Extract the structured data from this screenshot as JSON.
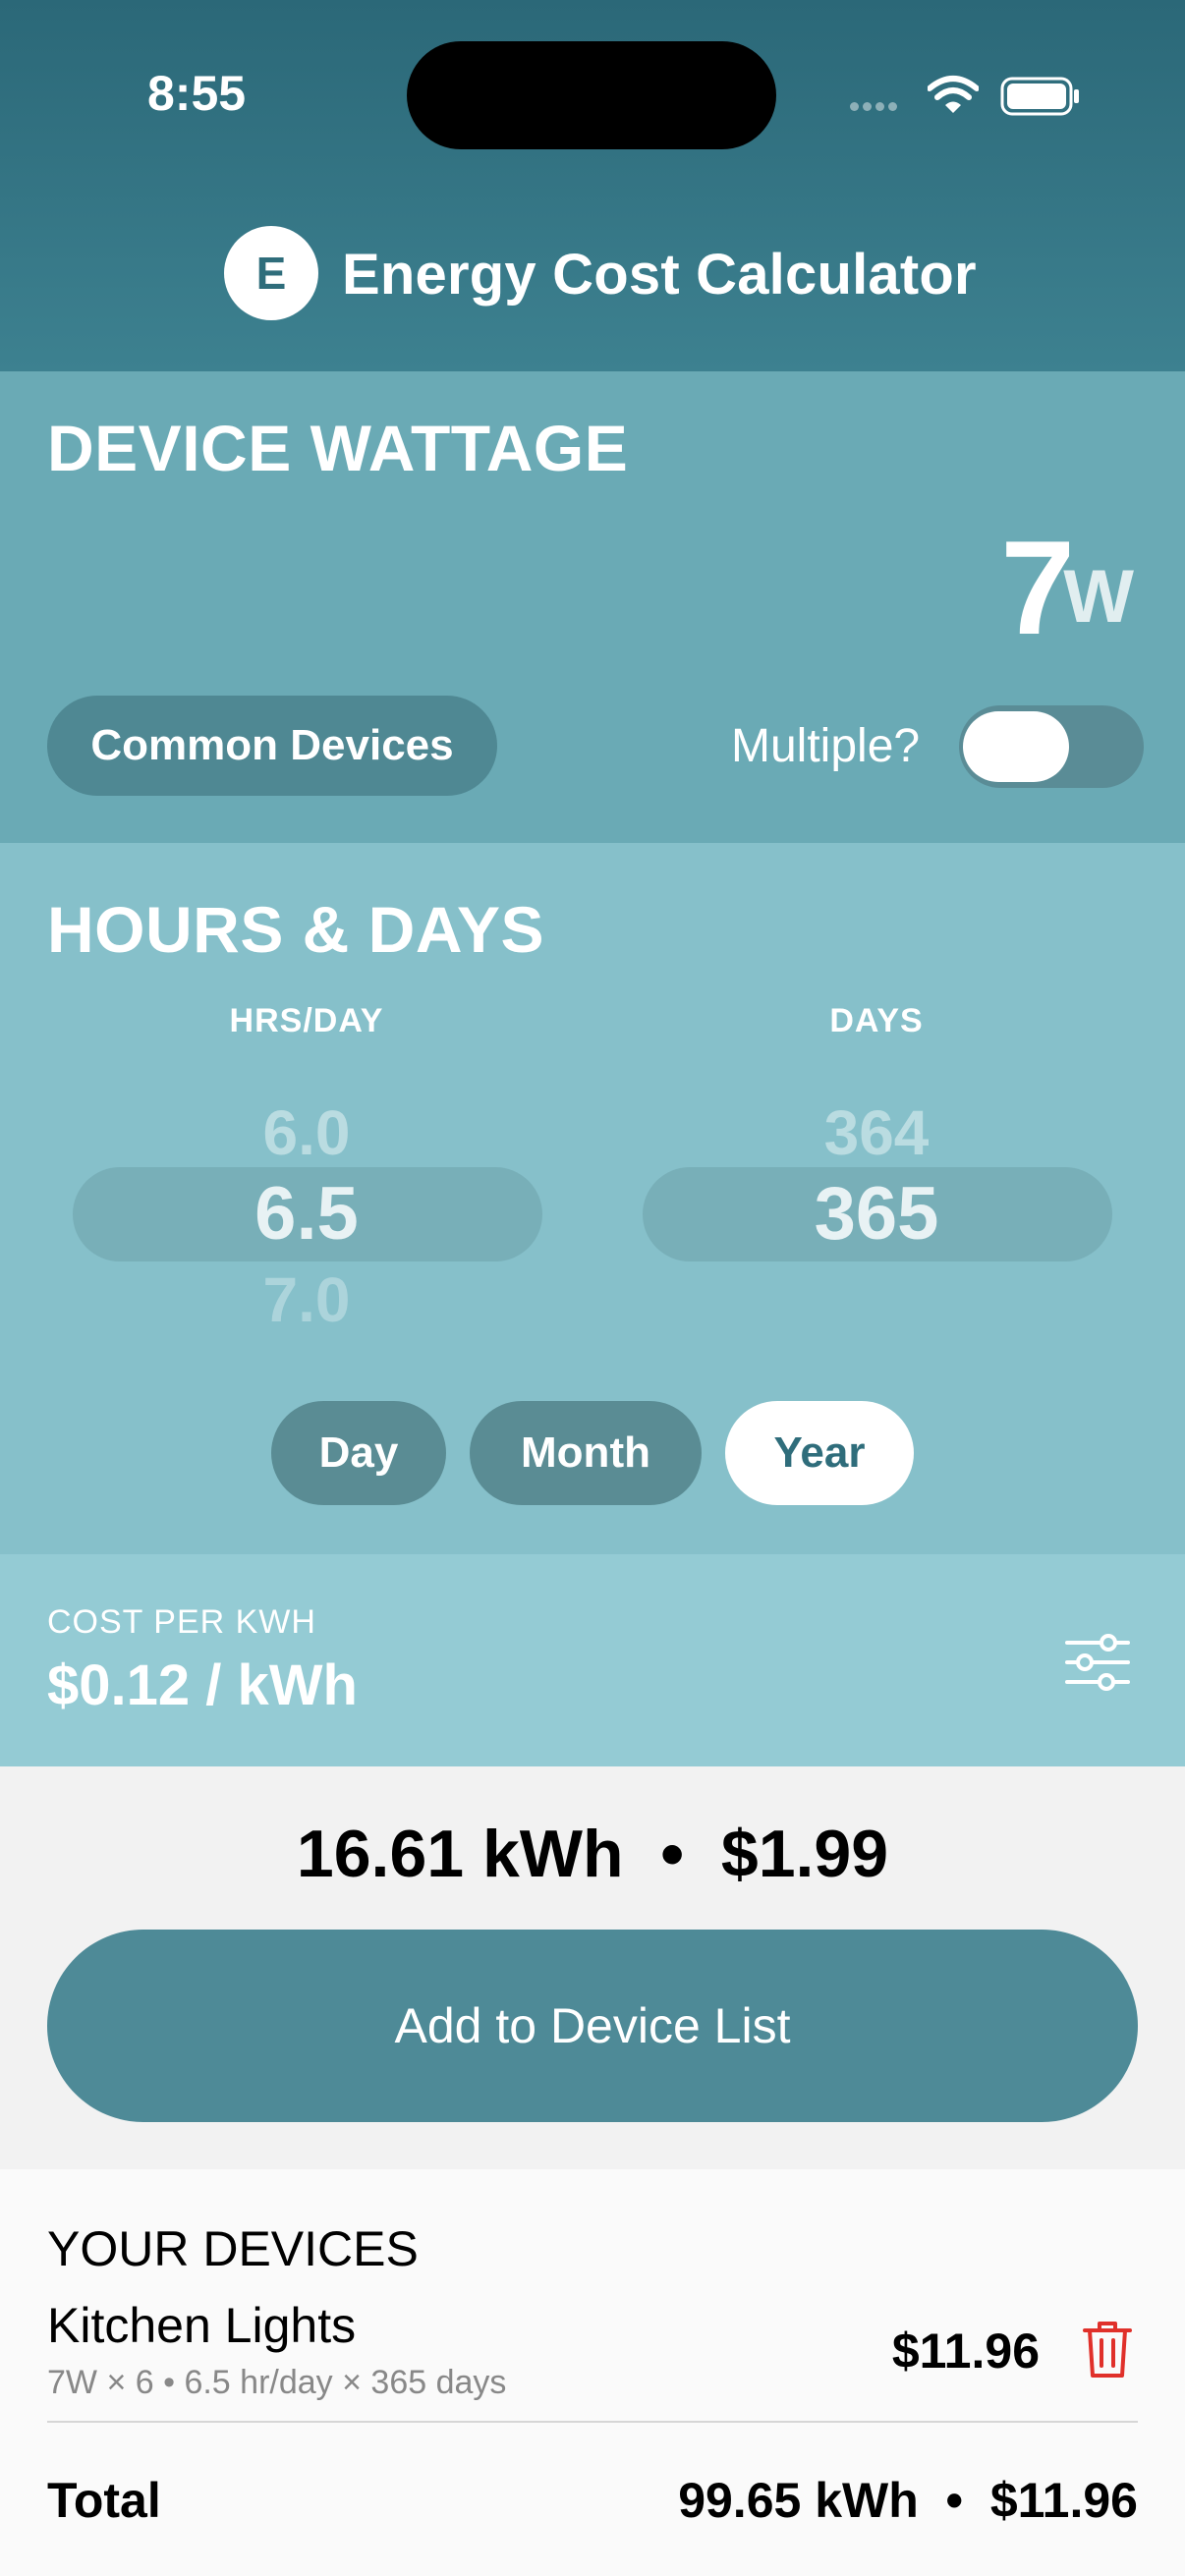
{
  "status_bar": {
    "time": "8:55"
  },
  "header": {
    "logo_letter": "E",
    "title": "Energy Cost Calculator"
  },
  "wattage": {
    "heading": "DEVICE WATTAGE",
    "value": "7",
    "unit": "W",
    "common_devices_label": "Common Devices",
    "multiple_label": "Multiple?",
    "multiple_on": false
  },
  "hours_days": {
    "heading": "HOURS & DAYS",
    "hrs_label": "HRS/DAY",
    "days_label": "DAYS",
    "hrs_prev": "6.0",
    "hrs_selected": "6.5",
    "hrs_next": "7.0",
    "days_prev": "364",
    "days_selected": "365",
    "periods": {
      "day": "Day",
      "month": "Month",
      "year": "Year"
    },
    "selected_period": "Year"
  },
  "cost": {
    "label": "COST PER KWH",
    "value": "$0.12 / kWh",
    "settings_icon": "sliders-icon"
  },
  "result": {
    "text": "16.61 kWh  •  $1.99",
    "add_button_label": "Add to Device List"
  },
  "devices": {
    "heading": "YOUR DEVICES",
    "items": [
      {
        "name": "Kitchen Lights",
        "detail": "7W × 6 • 6.5 hr/day × 365 days",
        "cost": "$11.96"
      }
    ],
    "total_label": "Total",
    "total_value": "99.65 kWh  •  $11.96"
  },
  "colors": {
    "header": "#2b6878",
    "wattage_bg": "#6aaab5",
    "hours_bg": "#86c0ca",
    "cost_bg": "#94cbd4",
    "accent_button": "#4e8a97",
    "delete": "#e0302a"
  }
}
